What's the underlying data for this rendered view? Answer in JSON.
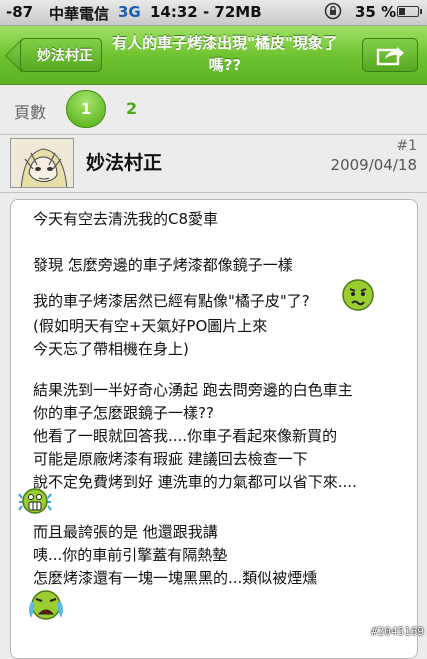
{
  "status_bar": {
    "signal": "-87",
    "carrier": "中華電信",
    "network": "3G",
    "time_mem": "14:32 - 72MB",
    "battery_percent": "35 %",
    "battery_level": 0.35,
    "lock_icon": "rotation-lock-icon"
  },
  "nav": {
    "back_label": "妙法村正",
    "title": "有人的車子烤漆出現\"橘皮\"現象了嗎??",
    "share_icon": "share-icon"
  },
  "pager": {
    "label": "頁數",
    "pages": [
      "1",
      "2"
    ],
    "current": "1"
  },
  "post": {
    "author": "妙法村正",
    "index": "#1",
    "date": "2009/04/18",
    "lines": [
      "今天有空去清洗我的C8愛車",
      "發現 怎麼旁邊的車子烤漆都像鏡子一樣",
      "我的車子烤漆居然已經有點像\"橘子皮\"了?",
      "(假如明天有空+天氣好PO圖片上來",
      "今天忘了帶相機在身上)",
      "結果洗到一半好奇心湧起 跑去問旁邊的白色車主",
      "你的車子怎麼跟鏡子一樣??",
      "他看了一眼就回答我....你車子看起來像新買的",
      "可能是原廠烤漆有瑕疵 建議回去檢查一下",
      "說不定免費烤到好 連洗車的力氣都可以省下來....",
      "而且最誇張的是 他還跟我講",
      "咦...你的車前引擎蓋有隔熱墊",
      "怎麼烤漆還有一塊一塊黑黑的...類似被煙燻"
    ],
    "emoticons": [
      "confused-smiley-icon",
      "shocked-smiley-icon",
      "crying-smiley-icon"
    ]
  },
  "watermark": "#2045169"
}
